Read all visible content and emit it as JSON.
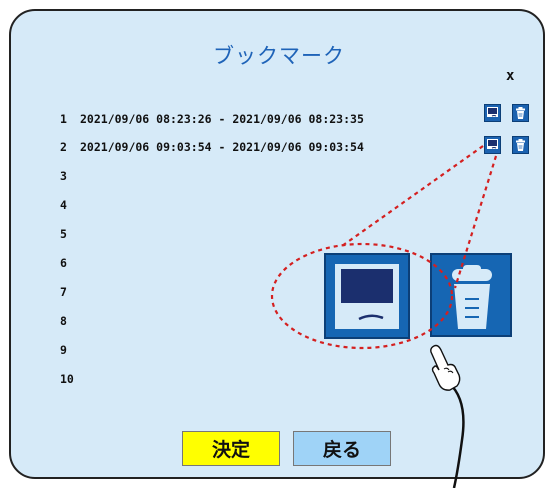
{
  "dialog": {
    "title": "ブックマーク",
    "close_label": "x"
  },
  "bookmarks": [
    {
      "num": "1",
      "range": "2021/09/06 08:23:26 - 2021/09/06 08:23:35"
    },
    {
      "num": "2",
      "range": "2021/09/06 09:03:54 - 2021/09/06 09:03:54"
    },
    {
      "num": "3",
      "range": ""
    },
    {
      "num": "4",
      "range": ""
    },
    {
      "num": "5",
      "range": ""
    },
    {
      "num": "6",
      "range": ""
    },
    {
      "num": "7",
      "range": ""
    },
    {
      "num": "8",
      "range": ""
    },
    {
      "num": "9",
      "range": ""
    },
    {
      "num": "10",
      "range": ""
    }
  ],
  "row_icons": [
    "play-bookmark-icon",
    "delete-bookmark-icon"
  ],
  "callout": {
    "icons": [
      "play-bookmark-icon",
      "trash-icon"
    ],
    "pointer": "pointing-hand-icon"
  },
  "buttons": {
    "confirm_label": "決定",
    "back_label": "戻る"
  },
  "colors": {
    "dialog_bg": "#d6eaf8",
    "title": "#1e63b8",
    "icon_blue": "#1666b3",
    "confirm_bg": "#ffff00",
    "back_bg": "#9fd3f7",
    "callout_dash": "#d42020"
  }
}
